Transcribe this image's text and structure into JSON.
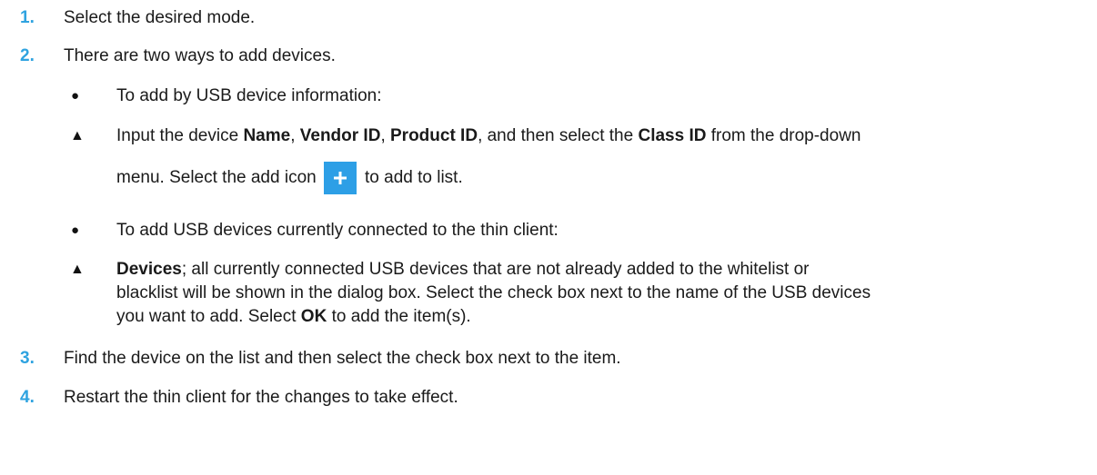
{
  "steps": {
    "s1": {
      "num": "1.",
      "text": "Select the desired mode."
    },
    "s2": {
      "num": "2.",
      "text": "There are two ways to add devices."
    },
    "s3": {
      "num": "3.",
      "text": "Find the device on the list and then select the check box next to the item."
    },
    "s4": {
      "num": "4.",
      "text": "Restart the thin client for the changes to take effect."
    }
  },
  "sub": {
    "b1": {
      "bullet": "●",
      "text": "To add by USB device information:"
    },
    "t1": {
      "marker": "▲",
      "p1": "Input the device ",
      "name": "Name",
      "c1": ", ",
      "vendor": "Vendor ID",
      "c2": ", ",
      "product": "Product ID",
      "p2": ", and then select the ",
      "classid": "Class ID",
      "p3": " from the drop-down",
      "l2a": "menu. Select the add icon",
      "l2b": "to add to list."
    },
    "b2": {
      "bullet": "●",
      "text": "To add USB devices currently connected to the thin client:"
    },
    "t2": {
      "marker": "▲",
      "devices": "Devices",
      "l1": "; all currently connected USB devices that are not already added to the whitelist or",
      "l2": "blacklist will be shown in the dialog box. Select the check box next to the name of the USB devices",
      "l3a": "you want to add. Select ",
      "ok": "OK",
      "l3b": " to add the item(s)."
    }
  },
  "icons": {
    "add": "plus-icon",
    "accent_color": "#2fa3e0",
    "icon_color": "#2d9fe6"
  }
}
